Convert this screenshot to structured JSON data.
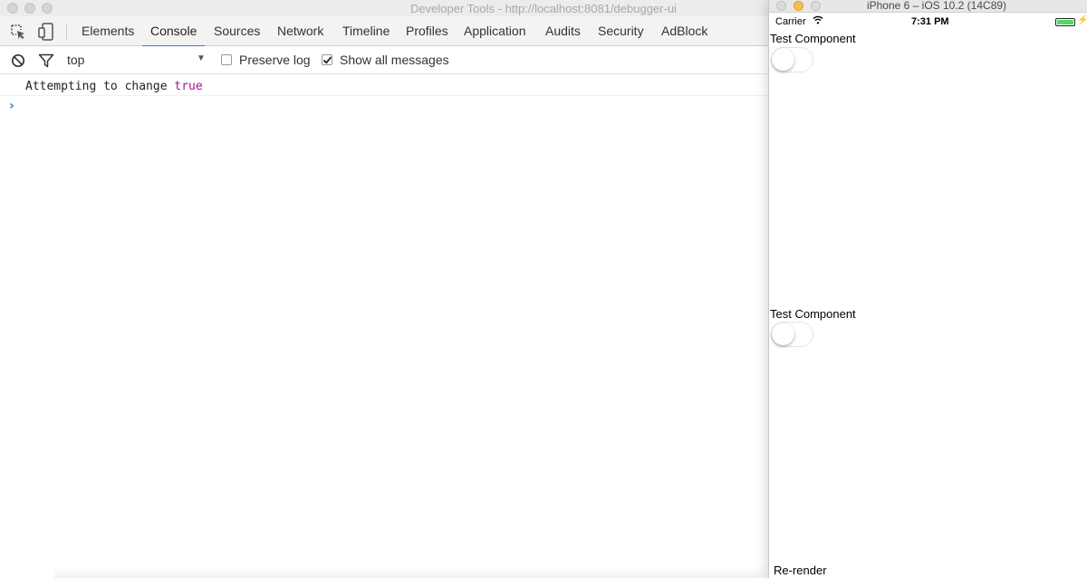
{
  "devtools": {
    "window_title": "Developer Tools - http://localhost:8081/debugger-ui",
    "tabs": [
      {
        "label": "Elements"
      },
      {
        "label": "Console"
      },
      {
        "label": "Sources"
      },
      {
        "label": "Network"
      },
      {
        "label": "Timeline"
      },
      {
        "label": "Profiles"
      },
      {
        "label": "Application"
      },
      {
        "label": "Audits"
      },
      {
        "label": "Security"
      },
      {
        "label": "AdBlock"
      }
    ],
    "active_tab": "Console",
    "filterbar": {
      "context": "top",
      "preserve_log_label": "Preserve log",
      "preserve_log_checked": false,
      "show_all_label": "Show all messages",
      "show_all_checked": true
    },
    "console": {
      "message_text": "Attempting to change",
      "message_value": "true",
      "prompt_symbol": "›"
    },
    "colors": {
      "accent": "#3879d9",
      "value_keyword": "#aa0d91"
    }
  },
  "simulator": {
    "window_title": "iPhone 6 – iOS 10.2 (14C89)",
    "statusbar": {
      "carrier": "Carrier",
      "time": "7:31 PM",
      "battery_charging": true
    },
    "components": [
      {
        "label": "Test Component",
        "switch_on": false
      },
      {
        "label": "Test Component",
        "switch_on": false
      }
    ],
    "rerender_label": "Re-render",
    "colors": {
      "battery": "#4cd964",
      "close_light": "#d4d4d4",
      "minimize_light": "#f5be4f"
    }
  }
}
